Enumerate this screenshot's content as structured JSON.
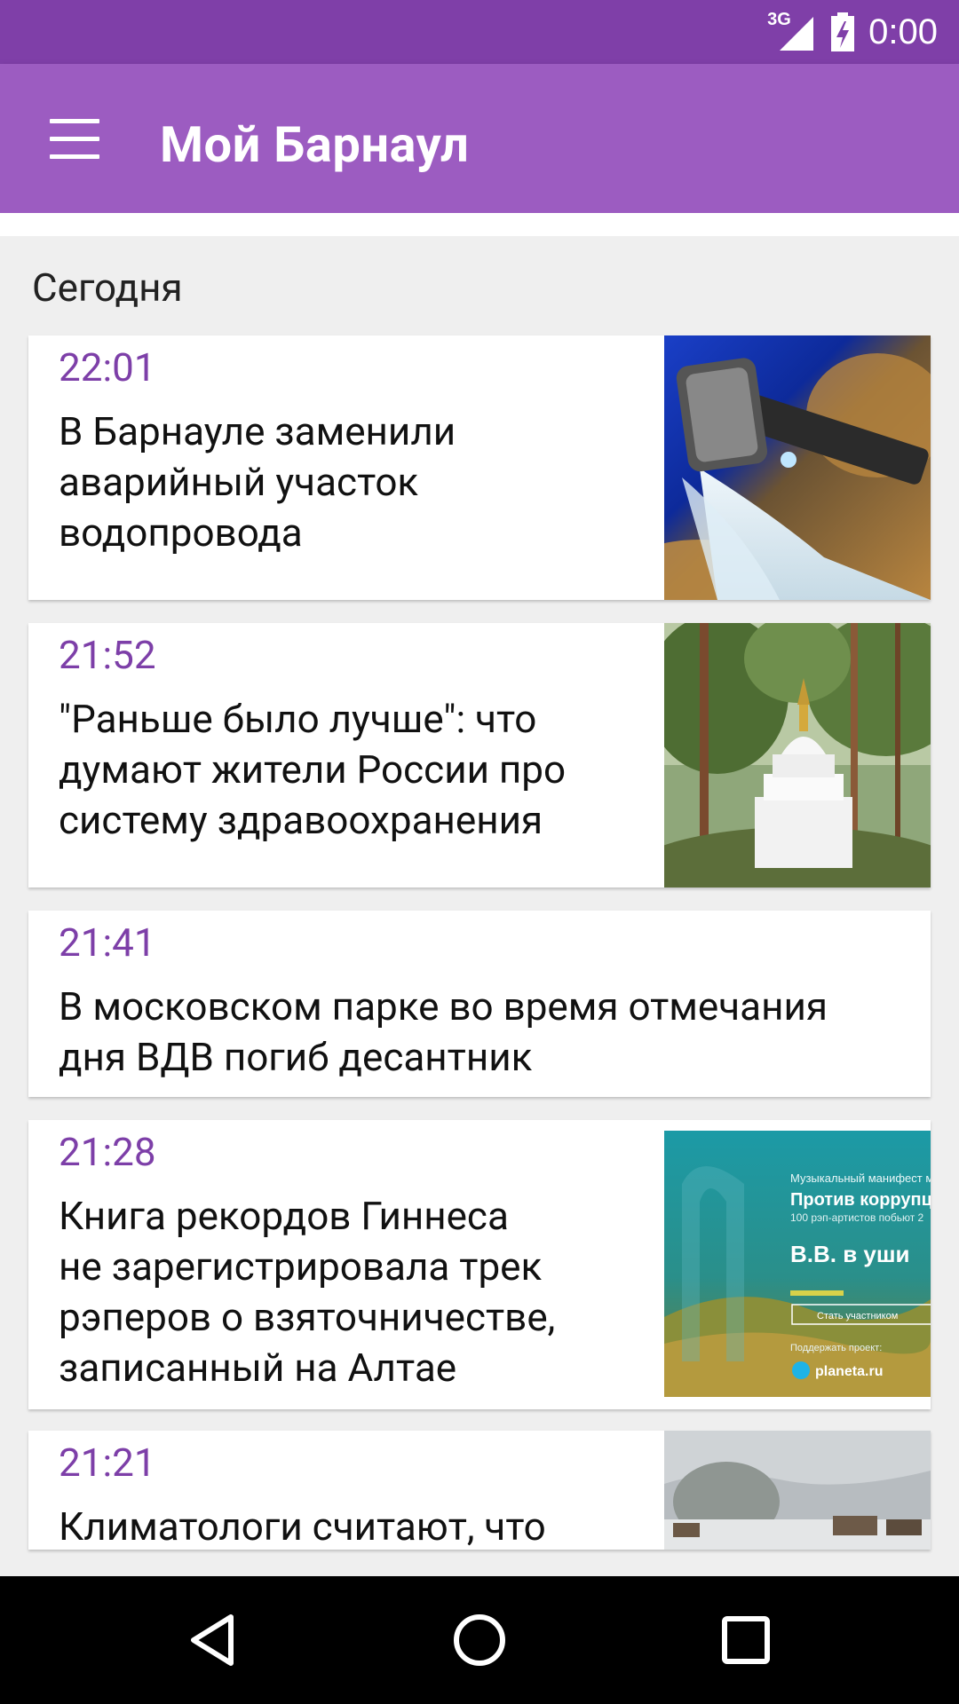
{
  "status_bar": {
    "network": "3G",
    "time": "0:00"
  },
  "app_bar": {
    "title": "Мой Барнаул",
    "menu_icon": "hamburger-menu-icon"
  },
  "feed": {
    "section_label": "Сегодня",
    "items": [
      {
        "time": "22:01",
        "title_lines": [
          "В Барнауле заменили",
          "аварийный участок",
          "водопровода"
        ],
        "image": "water-pipe-photo"
      },
      {
        "time": "21:52",
        "title_lines": [
          "\"Раньше было лучше\": что",
          "думают жители России про",
          "систему здравоохранения"
        ],
        "image": "stupa-forest-photo"
      },
      {
        "time": "21:41",
        "title_lines": [
          "В московском парке во время отмечания",
          "дня ВДВ погиб десантник"
        ],
        "image": null
      },
      {
        "time": "21:28",
        "title_lines": [
          "Книга рекордов Гиннеса",
          "не зарегистрировала трек",
          "рэперов о взяточничестве,",
          "записанный на Алтае"
        ],
        "image": "music-manifesto-banner",
        "image_text": {
          "line1": "Музыкальный манифест м",
          "line2": "Против коррупци",
          "line3": "100 рэп-артистов побьют 2",
          "line4": "В.В. в уши",
          "button": "Стать участником",
          "support": "Поддержать проект:",
          "brand": "planeta.ru"
        }
      },
      {
        "time": "21:21",
        "title_lines": [
          "Климатологи считают, что"
        ],
        "image": "snowy-village-photo"
      }
    ]
  },
  "nav_bar": {
    "back_icon": "back-triangle-icon",
    "home_icon": "home-circle-icon",
    "recents_icon": "recents-square-icon"
  }
}
